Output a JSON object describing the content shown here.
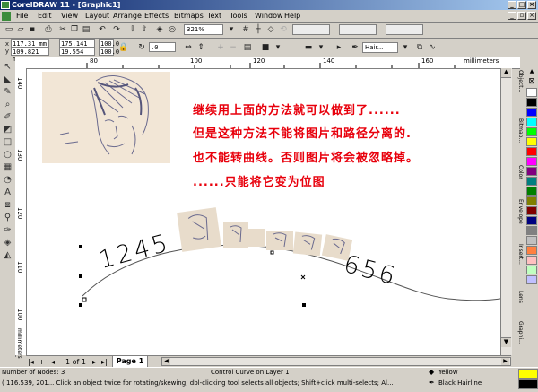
{
  "window": {
    "title": "CorelDRAW 11 - [Graphic1]"
  },
  "menu": [
    "File",
    "Edit",
    "View",
    "Layout",
    "Arrange",
    "Effects",
    "Bitmaps",
    "Text",
    "Tools",
    "Window",
    "Help"
  ],
  "zoom": "321%",
  "property_bar": {
    "x": "117.31 mm",
    "y": "109.821 mm",
    "width": "175.141 m",
    "height": "19.554 mm",
    "scale_w": "100.0",
    "scale_h": "100.0",
    "rotation": ".0",
    "outline_width": "Hair..."
  },
  "ruler": {
    "unit": "millimeters",
    "h_ticks": [
      "80",
      "100",
      "120",
      "140",
      "160"
    ],
    "v_ticks": [
      "140",
      "130",
      "120",
      "110",
      "100"
    ]
  },
  "canvas_text": [
    "继续用上面的方法就可以做到了......",
    "但是这种方法不能将图片和路径分离的.",
    "也不能转曲线。否则图片将会被忽略掉。",
    "......只能将它变为位图"
  ],
  "curve_text": {
    "left": "1245",
    "right": "656"
  },
  "dockers": [
    "Object...",
    "Bitmap...",
    "Color",
    "Envelope",
    "Insert...",
    "Lens",
    "Graphi..."
  ],
  "palette": [
    "#ffffff",
    "#000000",
    "#0000ff",
    "#00ffff",
    "#00ff00",
    "#ffff00",
    "#ff0000",
    "#ff00ff",
    "#800080",
    "#008080",
    "#008000",
    "#808000",
    "#800000",
    "#000080",
    "#808080",
    "#c0c0c0",
    "#ff8040",
    "#ffc0c0",
    "#c0ffc0",
    "#c0c0ff"
  ],
  "page_nav": {
    "counter": "1 of 1",
    "tab": "Page 1"
  },
  "status": {
    "nodes": "Number of Nodes: 3",
    "layer": "Control Curve on Layer 1",
    "fill_label": "Yellow",
    "outline_label": "Black  Hairline",
    "fill_color": "#ffff00",
    "hint": "( 116.539, 201... Click an object twice for rotating/skewing; dbl-clicking tool selects all objects; Shift+click multi-selects; Al..."
  }
}
